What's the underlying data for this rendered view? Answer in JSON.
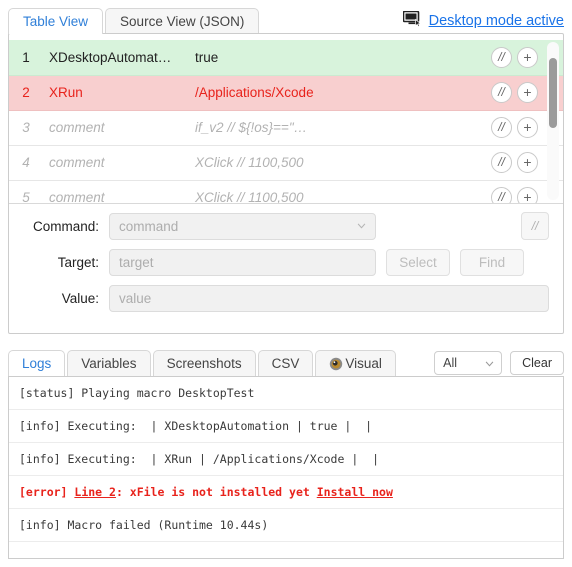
{
  "top_tabs": [
    {
      "label": "Table View",
      "active": true
    },
    {
      "label": "Source View (JSON)",
      "active": false
    }
  ],
  "desktop_mode": {
    "label": "Desktop mode active",
    "icon": "monitor-icon",
    "link_color": "#1a73e8"
  },
  "table": {
    "rows": [
      {
        "num": "1",
        "command": "XDesktopAutomat…",
        "target": "true",
        "state": "green",
        "comment_btn": "//",
        "add_btn": "+"
      },
      {
        "num": "2",
        "command": "XRun",
        "target": "/Applications/Xcode",
        "state": "red",
        "comment_btn": "//",
        "add_btn": "+"
      },
      {
        "num": "3",
        "command": "comment",
        "target": "if_v2 // ${!os}==\"…",
        "state": "comment",
        "comment_btn": "//",
        "add_btn": "+"
      },
      {
        "num": "4",
        "command": "comment",
        "target": "XClick // 1100,500",
        "state": "comment",
        "comment_btn": "//",
        "add_btn": "+"
      },
      {
        "num": "5",
        "command": "comment",
        "target": "XClick // 1100,500",
        "state": "comment",
        "comment_btn": "//",
        "add_btn": "+"
      }
    ],
    "row_colors": {
      "green": "#d8f3dc",
      "red": "#f8cfcf",
      "error_text": "#e8231c"
    }
  },
  "form": {
    "command_label": "Command:",
    "command_placeholder": "command",
    "target_label": "Target:",
    "target_placeholder": "target",
    "value_label": "Value:",
    "value_placeholder": "value",
    "select_button": "Select",
    "find_button": "Find",
    "comment_button": "//"
  },
  "log_tabs": [
    {
      "label": "Logs",
      "active": true,
      "icon": ""
    },
    {
      "label": "Variables",
      "active": false,
      "icon": ""
    },
    {
      "label": "Screenshots",
      "active": false,
      "icon": ""
    },
    {
      "label": "CSV",
      "active": false,
      "icon": ""
    },
    {
      "label": "Visual",
      "active": false,
      "icon": "eye-icon"
    }
  ],
  "log_tools": {
    "filter_value": "All",
    "clear_label": "Clear"
  },
  "logs": [
    {
      "type": "status",
      "text": "[status] Playing macro DesktopTest"
    },
    {
      "type": "info",
      "text": "[info] Executing:  | XDesktopAutomation | true |  |"
    },
    {
      "type": "info",
      "text": "[info] Executing:  | XRun | /Applications/Xcode |  |"
    },
    {
      "type": "error",
      "prefix": "[error] ",
      "link1": "Line 2",
      "middle": ": xFile is not installed yet ",
      "link2": "Install now"
    },
    {
      "type": "info",
      "text": "[info] Macro failed (Runtime 10.44s)"
    }
  ]
}
